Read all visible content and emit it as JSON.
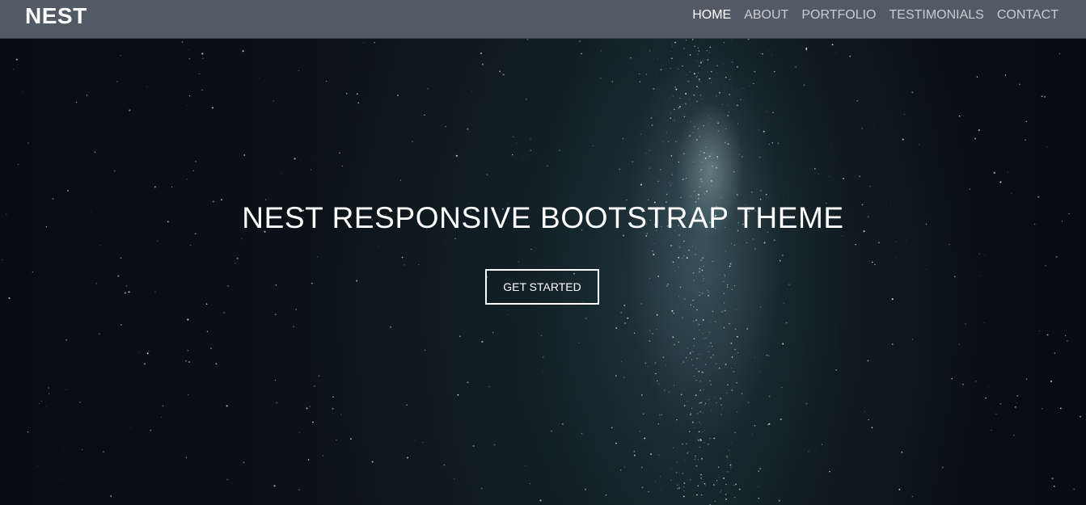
{
  "navbar": {
    "brand": "NEST",
    "items": [
      {
        "label": "HOME",
        "active": true
      },
      {
        "label": "ABOUT",
        "active": false
      },
      {
        "label": "PORTFOLIO",
        "active": false
      },
      {
        "label": "TESTIMONIALS",
        "active": false
      },
      {
        "label": "CONTACT",
        "active": false
      }
    ]
  },
  "hero": {
    "title": "NEST RESPONSIVE BOOTSTRAP THEME",
    "cta_label": "GET STARTED"
  },
  "colors": {
    "navbar_bg": "#525a66",
    "nav_text": "#c8cdd3",
    "nav_active": "#ffffff",
    "hero_bg": "#0b1116",
    "cta_border": "#ffffff"
  }
}
